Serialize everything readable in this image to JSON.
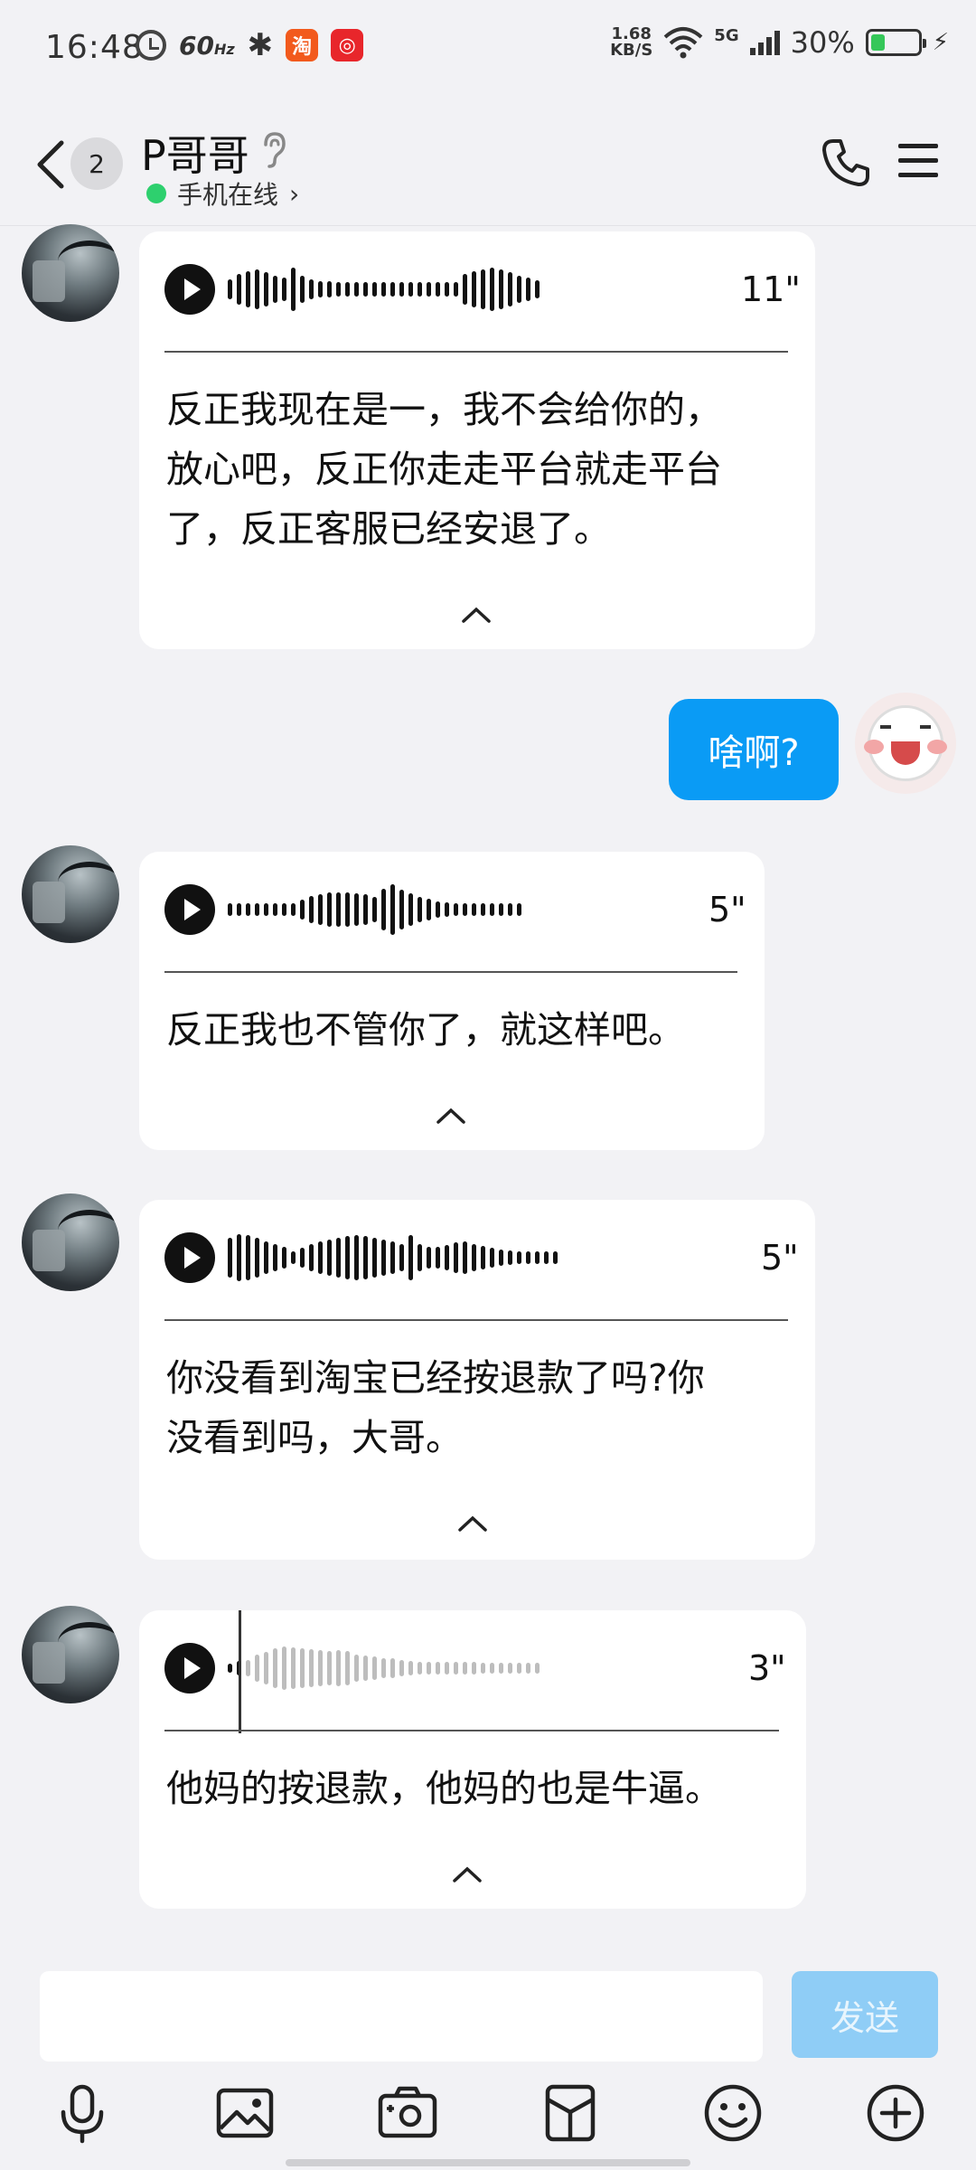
{
  "status_bar": {
    "time": "16:48",
    "refresh_rate": "60",
    "refresh_unit": "Hz",
    "app1_glyph": "淘",
    "app2_glyph": "◎",
    "net_speed_value": "1.68",
    "net_speed_unit": "KB/S",
    "network_type": "5G",
    "battery_percent": "30%",
    "battery_level": 0.3
  },
  "header": {
    "unread_count": "2",
    "contact_name": "P哥哥",
    "presence": "手机在线",
    "presence_chevron": "›"
  },
  "messages": [
    {
      "direction": "incoming",
      "type": "voice",
      "duration": "11\"",
      "transcript_lines": [
        "反正我现在是一，我不会给你的，",
        "放心吧，反正你走走平台就走平台",
        "了，反正客服已经安退了。"
      ]
    },
    {
      "direction": "outgoing",
      "type": "text",
      "text": "啥啊?"
    },
    {
      "direction": "incoming",
      "type": "voice",
      "duration": "5\"",
      "transcript_lines": [
        "反正我也不管你了，就这样吧。"
      ]
    },
    {
      "direction": "incoming",
      "type": "voice",
      "duration": "5\"",
      "transcript_lines": [
        "你没看到淘宝已经按退款了吗?你",
        "没看到吗，大哥。"
      ]
    },
    {
      "direction": "incoming",
      "type": "voice",
      "duration": "3\"",
      "playing": true,
      "transcript_lines": [
        "他妈的按退款，他妈的也是牛逼。"
      ]
    }
  ],
  "composer": {
    "input_value": "",
    "send_label": "发送"
  },
  "toolbar": {
    "icons": [
      "microphone-icon",
      "image-icon",
      "camera-icon",
      "file-icon",
      "emoji-icon",
      "plus-icon"
    ]
  },
  "colors": {
    "outgoing_bubble": "#0a9bf5",
    "send_button_disabled": "#8fcdf6",
    "online_dot": "#2ed06e",
    "background": "#f2f2f5"
  }
}
